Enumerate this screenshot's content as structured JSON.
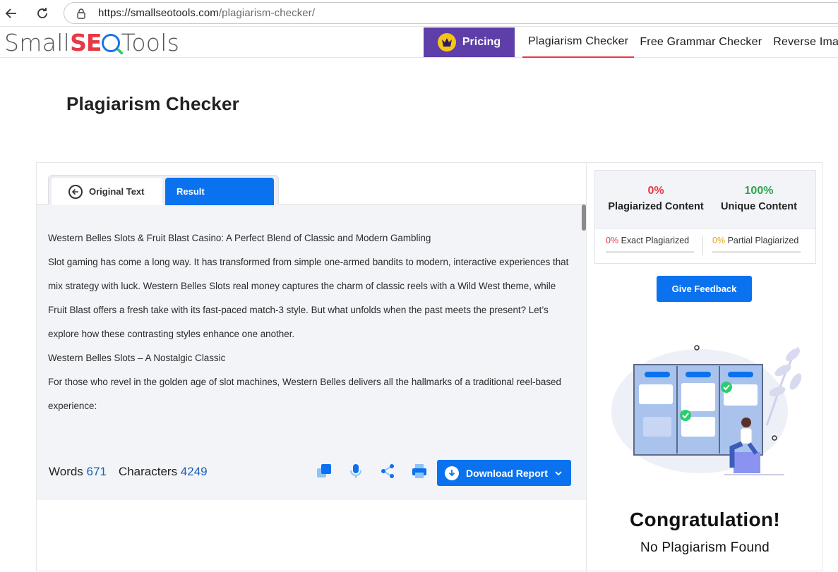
{
  "browser": {
    "url_host": "https://smallseotools.com",
    "url_path": "/plagiarism-checker/"
  },
  "header": {
    "logo_small": "Small",
    "logo_seo": "SE",
    "logo_tools": "Tools",
    "pricing_label": "Pricing",
    "nav": [
      {
        "label": "Plagiarism Checker"
      },
      {
        "label": "Free Grammar Checker"
      },
      {
        "label": "Reverse Imag"
      }
    ]
  },
  "page": {
    "title": "Plagiarism Checker"
  },
  "tabs": {
    "original": "Original Text",
    "result": "Result"
  },
  "text": [
    "Western Belles Slots & Fruit Blast Casino: A Perfect Blend of Classic and Modern Gambling",
    "Slot gaming has come a long way. It has transformed from simple one-armed bandits to modern, interactive experiences that mix strategy with luck. Western Belles Slots real money captures the charm of classic reels with a Wild West theme, while Fruit Blast offers a fresh take with its fast-paced match-3 style. But what unfolds when the past meets the present? Let’s explore how these contrasting styles enhance one another.",
    "Western Belles Slots – A Nostalgic Classic",
    "For those who revel in the golden age of slot machines, Western Belles delivers all the hallmarks of a traditional reel-based experience:"
  ],
  "stats": {
    "words_label": "Words",
    "words_value": "671",
    "chars_label": "Characters",
    "chars_value": "4249"
  },
  "actions": {
    "download_label": "Download Report",
    "feedback_label": "Give Feedback"
  },
  "score": {
    "plagiarized_pct": "0%",
    "plagiarized_label": "Plagiarized Content",
    "unique_pct": "100%",
    "unique_label": "Unique Content",
    "exact_pct": "0%",
    "exact_label": "Exact Plagiarized",
    "partial_pct": "0%",
    "partial_label": "Partial Plagiarized"
  },
  "result": {
    "title": "Congratulation!",
    "subtitle": "No Plagiarism Found"
  },
  "colors": {
    "brand_blue": "#0b72ef",
    "pricing_purple": "#5e3ea8",
    "red": "#e63946",
    "green": "#2ea44f"
  }
}
